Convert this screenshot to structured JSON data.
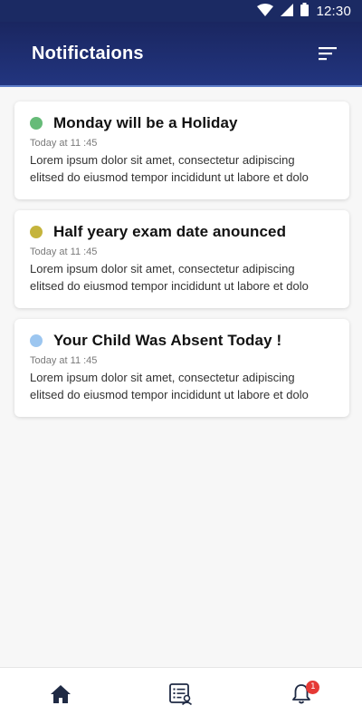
{
  "status_bar": {
    "time": "12:30",
    "icons": [
      "wifi-icon",
      "signal-icon",
      "battery-icon"
    ]
  },
  "header": {
    "title": "Notifictaions",
    "filter_icon": "filter-sort-icon"
  },
  "notifications": [
    {
      "title": "Monday will be a Holiday",
      "time": "Today at 11 :45",
      "line1": "Lorem ipsum dolor sit amet, consectetur adipiscing",
      "line2": "elitsed do eiusmod tempor incididunt ut labore et dolo",
      "dot_color": "#66bb78"
    },
    {
      "title": "Half yeary exam date anounced",
      "time": "Today at 11 :45",
      "line1": "Lorem ipsum dolor sit amet, consectetur adipiscing",
      "line2": "elitsed do eiusmod tempor incididunt ut labore et dolo",
      "dot_color": "#c5b43c"
    },
    {
      "title": "Your Child Was Absent Today !",
      "time": "Today at 11 :45",
      "line1": "Lorem ipsum dolor sit amet, consectetur adipiscing",
      "line2": "elitsed do eiusmod tempor incididunt ut labore et dolo",
      "dot_color": "#9cc6f0"
    }
  ],
  "bottom_nav": {
    "items": [
      "home-icon",
      "list-icon",
      "bell-icon"
    ],
    "bell_badge": "1"
  },
  "colors": {
    "header_bg": "#1e2e70",
    "badge": "#e53935"
  }
}
